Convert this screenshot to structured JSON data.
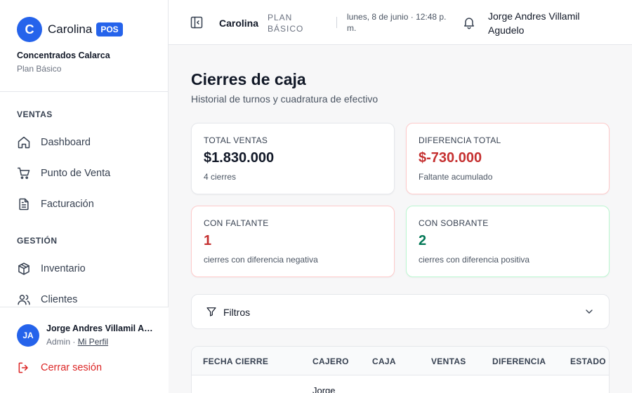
{
  "brand": {
    "logo_letter": "C",
    "name": "Carolina",
    "badge": "POS",
    "accent": "#2563eb"
  },
  "company": {
    "name": "Concentrados Calarca",
    "plan": "Plan Básico"
  },
  "sidebar": {
    "sections": [
      {
        "label": "VENTAS",
        "items": [
          {
            "label": "Dashboard",
            "icon": "home-icon"
          },
          {
            "label": "Punto de Venta",
            "icon": "cart-icon"
          },
          {
            "label": "Facturación",
            "icon": "file-text-icon"
          }
        ]
      },
      {
        "label": "GESTIÓN",
        "items": [
          {
            "label": "Inventario",
            "icon": "box-icon"
          },
          {
            "label": "Clientes",
            "icon": "users-icon"
          }
        ]
      }
    ]
  },
  "user": {
    "initials": "JA",
    "name": "Jorge Andres Villamil Ag...",
    "role": "Admin",
    "role_sep": " · ",
    "profile_link": "Mi Perfil",
    "logout": "Cerrar sesión"
  },
  "header": {
    "company": "Carolina",
    "plan": "PLAN BÁSICO",
    "datetime": "lunes, 8 de junio · 12:48 p. m.",
    "user_name": "Jorge Andres Villamil Agudelo"
  },
  "page": {
    "title": "Cierres de caja",
    "subtitle": "Historial de turnos y cuadratura de efectivo"
  },
  "stats": [
    {
      "label": "TOTAL VENTAS",
      "value": "$1.830.000",
      "sub": "4 cierres",
      "tone": "neutral"
    },
    {
      "label": "DIFERENCIA TOTAL",
      "value": "$-730.000",
      "sub": "Faltante acumulado",
      "tone": "red"
    },
    {
      "label": "CON FALTANTE",
      "value": "1",
      "sub": "cierres con diferencia negativa",
      "tone": "red"
    },
    {
      "label": "CON SOBRANTE",
      "value": "2",
      "sub": "cierres con diferencia positiva",
      "tone": "green"
    }
  ],
  "filters": {
    "label": "Filtros"
  },
  "table": {
    "columns": [
      "FECHA CIERRE",
      "CAJERO",
      "CAJA",
      "VENTAS",
      "DIFERENCIA",
      "ESTADO"
    ],
    "first_row_partial": {
      "cajero": "Jorge"
    }
  },
  "colors": {
    "danger": "#c53030",
    "success": "#047857",
    "border": "#e5e7eb"
  }
}
